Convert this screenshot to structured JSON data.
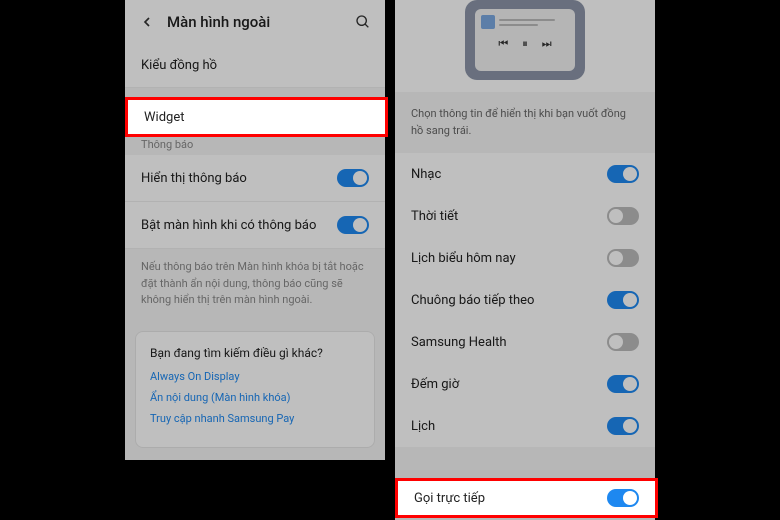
{
  "left": {
    "header": {
      "title": "Màn hình ngoài"
    },
    "clock_style": "Kiểu đồng hồ",
    "widget": "Widget",
    "notif_section": "Thông báo",
    "show_notif": {
      "label": "Hiển thị thông báo",
      "on": true
    },
    "screen_on_notif": {
      "label": "Bật màn hình khi có thông báo",
      "on": true
    },
    "help": "Nếu thông báo trên Màn hình khóa bị tắt hoặc đặt thành ẩn nội dung, thông báo cũng sẽ không hiển thị trên màn hình ngoài.",
    "card": {
      "title": "Bạn đang tìm kiếm điều gì khác?",
      "links": [
        "Always On Display",
        "Ẩn nội dung (Màn hình khóa)",
        "Truy cập nhanh Samsung Pay"
      ]
    }
  },
  "right": {
    "info": "Chọn thông tin để hiển thị khi bạn vuốt đồng hồ sang trái.",
    "items": [
      {
        "label": "Nhạc",
        "on": true
      },
      {
        "label": "Thời tiết",
        "on": false
      },
      {
        "label": "Lịch biểu hôm nay",
        "on": false
      },
      {
        "label": "Chuông báo tiếp theo",
        "on": true
      },
      {
        "label": "Samsung Health",
        "on": false
      },
      {
        "label": "Đếm giờ",
        "on": true
      },
      {
        "label": "Lịch",
        "on": true
      }
    ],
    "direct_call": {
      "label": "Gọi trực tiếp",
      "on": true
    }
  }
}
